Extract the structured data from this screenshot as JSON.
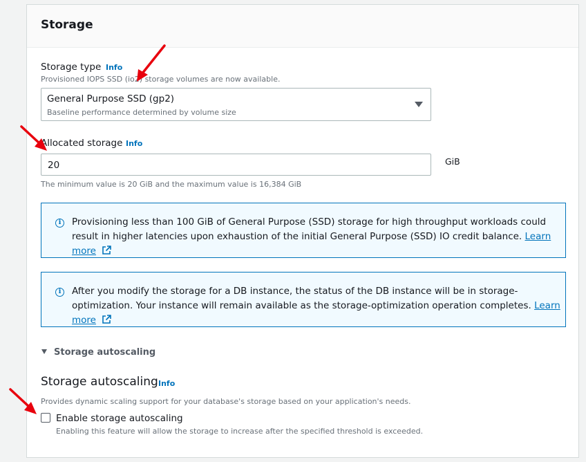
{
  "storage": {
    "title": "Storage",
    "storage_type": {
      "label": "Storage type",
      "info": "Info",
      "notice": "Provisioned IOPS SSD (io2) storage volumes are now available.",
      "selected": "General Purpose SSD (gp2)",
      "selected_desc": "Baseline performance determined by volume size"
    },
    "allocated_storage": {
      "label": "Allocated storage",
      "info": "Info",
      "value": "20",
      "unit": "GiB",
      "constraint": "The minimum value is 20 GiB and the maximum value is 16,384 GiB"
    },
    "alerts": [
      {
        "text": "Provisioning less than 100 GiB of General Purpose (SSD) storage for high throughput workloads could result in higher latencies upon exhaustion of the initial General Purpose (SSD) IO credit balance.",
        "link": "Learn more"
      },
      {
        "text": "After you modify the storage for a DB instance, the status of the DB instance will be in storage-optimization. Your instance will remain available as the storage-optimization operation completes.",
        "link": "Learn more"
      }
    ],
    "autoscaling": {
      "expander_label": "Storage autoscaling",
      "heading": "Storage autoscaling",
      "info": "Info",
      "description": "Provides dynamic scaling support for your database's storage based on your application's needs.",
      "checkbox_label": "Enable storage autoscaling",
      "checkbox_checked": false,
      "checkbox_desc": "Enabling this feature will allow the storage to increase after the specified threshold is exceeded."
    }
  },
  "colors": {
    "accent": "#0073bb",
    "arrow": "#e8000d",
    "alert_bg": "#f1faff"
  },
  "icons": [
    "caret-down-icon",
    "info-circle-icon",
    "external-link-icon",
    "expand-triangle-icon",
    "annotation-arrow-icon"
  ]
}
